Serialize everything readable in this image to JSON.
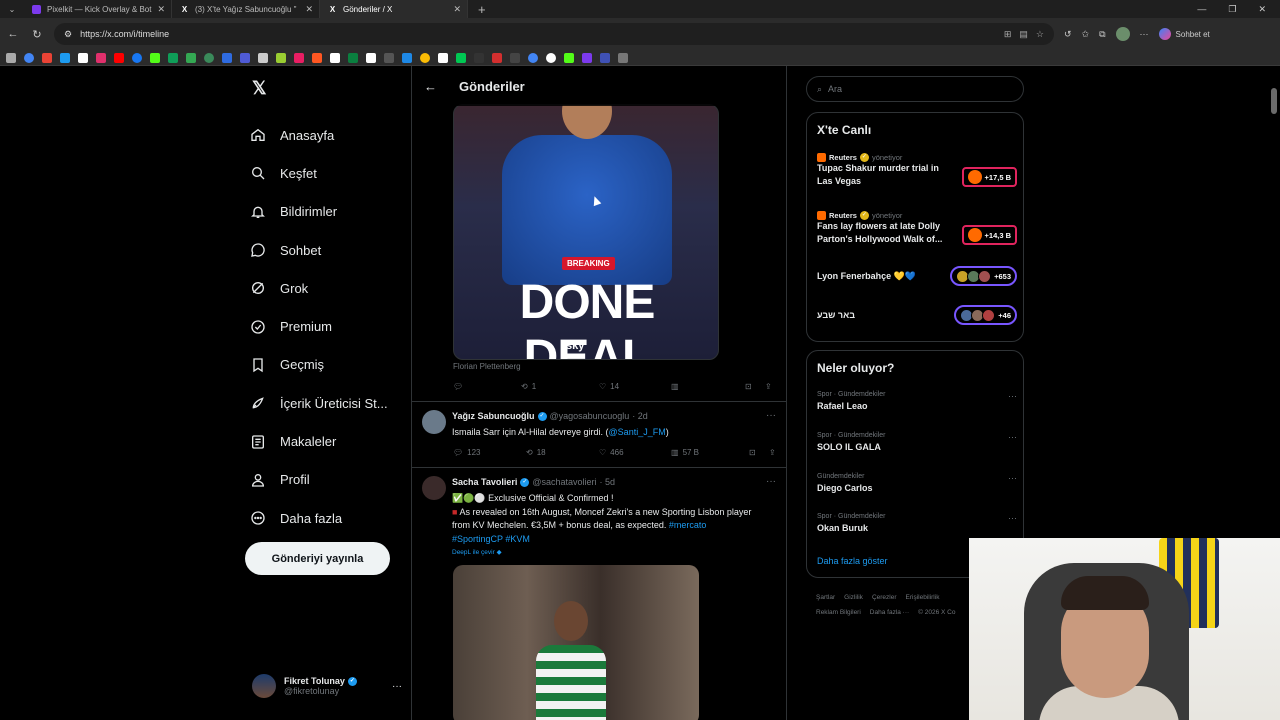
{
  "browser": {
    "tabs": [
      {
        "title": "Pixelkit — Kick Overlay & Bot",
        "active": false
      },
      {
        "title": "(3) X'te Yağız Sabuncuoğlu \"",
        "active": false
      },
      {
        "title": "Gönderiler / X",
        "active": true
      }
    ],
    "url": "https://x.com/i/timeline",
    "copilot_label": "Sohbet et"
  },
  "sidebar": {
    "items": [
      {
        "label": "Anasayfa",
        "icon": "home-icon"
      },
      {
        "label": "Keşfet",
        "icon": "search-icon"
      },
      {
        "label": "Bildirimler",
        "icon": "bell-icon"
      },
      {
        "label": "Sohbet",
        "icon": "chat-icon"
      },
      {
        "label": "Grok",
        "icon": "grok-icon"
      },
      {
        "label": "Premium",
        "icon": "premium-icon"
      },
      {
        "label": "Geçmiş",
        "icon": "bookmark-icon"
      },
      {
        "label": "İçerik Üreticisi St...",
        "icon": "rocket-icon"
      },
      {
        "label": "Makaleler",
        "icon": "article-icon"
      },
      {
        "label": "Profil",
        "icon": "profile-icon"
      },
      {
        "label": "Daha fazla",
        "icon": "more-circle-icon"
      }
    ],
    "post_button": "Gönderiyi yayınla",
    "account": {
      "name": "Fikret Tolunay",
      "handle": "@fikretolunay"
    }
  },
  "main": {
    "header_title": "Gönderiler",
    "post1": {
      "media": {
        "badge": "BREAKING",
        "headline": "DONE DEAL",
        "brand": "sky"
      },
      "credit": "Florian Plettenberg",
      "reposts": "1",
      "likes": "14"
    },
    "post2": {
      "name": "Yağız Sabuncuoğlu",
      "handle": "@yagosabuncuoglu",
      "time": "· 2d",
      "text": "Ismaila Sarr için Al-Hilal devreye girdi. (",
      "mention": "@Santi_J_FM",
      "text_end": ")",
      "replies": "123",
      "reposts": "18",
      "likes": "466",
      "views": "57 B"
    },
    "post3": {
      "name": "Sacha Tavolieri",
      "handle": "@sachatavolieri",
      "time": "· 5d",
      "line1": "Exclusive Official & Confirmed !",
      "line2": "As revealed on 16th August, Moncef Zekri's a new Sporting Lisbon player from KV Mechelen. €3,5M + bonus deal, as expected.",
      "hashtags_inline": "#mercato",
      "hashtags_line": "#SportingCP #KVM",
      "translate": "DeepL ile çevir"
    }
  },
  "right": {
    "search_placeholder": "Ara",
    "live": {
      "title": "X'te Canlı",
      "items": [
        {
          "source": "Reuters",
          "status": "yönetiyor",
          "text": "Tupac Shakur murder trial in Las Vegas",
          "count": "+17,5 B"
        },
        {
          "source": "Reuters",
          "status": "yönetiyor",
          "text": "Fans lay flowers at late Dolly Parton's Hollywood Walk of...",
          "count": "+14,3 B"
        },
        {
          "source": "",
          "status": "",
          "text": "Lyon Fenerbahçe 💛💙",
          "count": "+653"
        },
        {
          "source": "",
          "status": "",
          "text": "באר שבע",
          "count": "+46"
        }
      ]
    },
    "trends": {
      "title": "Neler oluyor?",
      "items": [
        {
          "category": "Spor · Gündemdekiler",
          "name": "Rafael Leao"
        },
        {
          "category": "Spor · Gündemdekiler",
          "name": "SOLO IL GALA"
        },
        {
          "category": "Gündemdekiler",
          "name": "Diego Carlos"
        },
        {
          "category": "Spor · Gündemdekiler",
          "name": "Okan Buruk"
        }
      ],
      "show_more": "Daha fazla göster"
    },
    "footer": {
      "line1": [
        "Şartlar",
        "Gizlilik",
        "Çerezler",
        "Erişilebilirlik"
      ],
      "line2": [
        "Reklam Bilgileri",
        "Daha fazla ···",
        "© 2026 X Co"
      ]
    }
  },
  "colors": {
    "accent": "#1d9bf0",
    "background": "#000000",
    "border": "#2f3336",
    "muted": "#71767b"
  }
}
